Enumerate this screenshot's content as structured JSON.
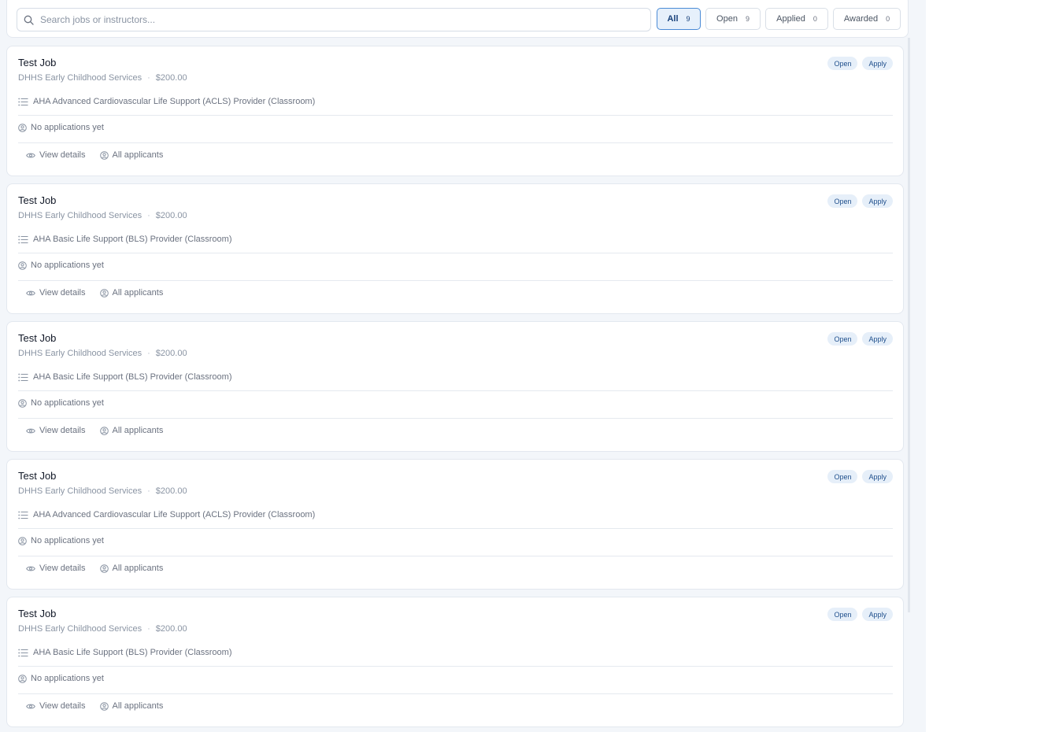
{
  "search": {
    "placeholder": "Search jobs or instructors..."
  },
  "filters": [
    {
      "label": "All",
      "count": "9"
    },
    {
      "label": "Open",
      "count": "9"
    },
    {
      "label": "Applied",
      "count": "0"
    },
    {
      "label": "Awarded",
      "count": "0"
    }
  ],
  "jobs": [
    {
      "title": "Test Job",
      "organization": "DHHS Early Childhood Services",
      "separator": "·",
      "price": "$200.00",
      "status": "Open",
      "apply_label": "Apply",
      "course": "AHA Advanced Cardiovascular Life Support (ACLS) Provider (Classroom)",
      "applications": "No applications yet",
      "view_details": "View details",
      "all_applicants": "All applicants"
    },
    {
      "title": "Test Job",
      "organization": "DHHS Early Childhood Services",
      "separator": "·",
      "price": "$200.00",
      "status": "Open",
      "apply_label": "Apply",
      "course": "AHA Basic Life Support (BLS) Provider (Classroom)",
      "applications": "No applications yet",
      "view_details": "View details",
      "all_applicants": "All applicants"
    },
    {
      "title": "Test Job",
      "organization": "DHHS Early Childhood Services",
      "separator": "·",
      "price": "$200.00",
      "status": "Open",
      "apply_label": "Apply",
      "course": "AHA Basic Life Support (BLS) Provider (Classroom)",
      "applications": "No applications yet",
      "view_details": "View details",
      "all_applicants": "All applicants"
    },
    {
      "title": "Test Job",
      "organization": "DHHS Early Childhood Services",
      "separator": "·",
      "price": "$200.00",
      "status": "Open",
      "apply_label": "Apply",
      "course": "AHA Advanced Cardiovascular Life Support (ACLS) Provider (Classroom)",
      "applications": "No applications yet",
      "view_details": "View details",
      "all_applicants": "All applicants"
    },
    {
      "title": "Test Job",
      "organization": "DHHS Early Childhood Services",
      "separator": "·",
      "price": "$200.00",
      "status": "Open",
      "apply_label": "Apply",
      "course": "AHA Basic Life Support (BLS) Provider (Classroom)",
      "applications": "No applications yet",
      "view_details": "View details",
      "all_applicants": "All applicants"
    }
  ],
  "icons": {
    "search": "search-icon",
    "list": "list-icon",
    "user": "user-circle-icon",
    "eye": "eye-icon"
  },
  "colors": {
    "accent": "#4a8bd6",
    "badge_bg": "#e6eff9",
    "badge_text": "#1f4f8c"
  }
}
